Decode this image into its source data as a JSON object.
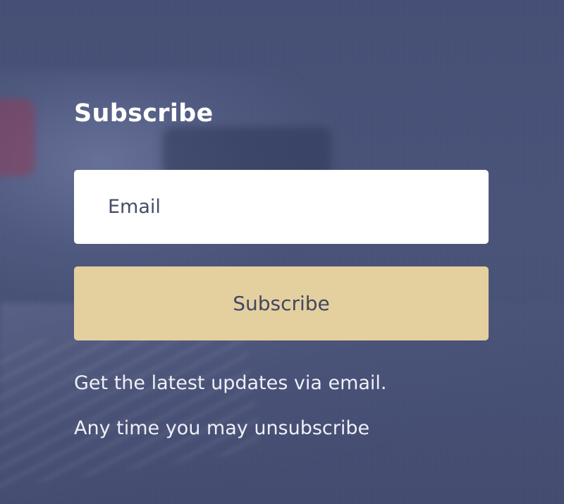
{
  "subscribe": {
    "heading": "Subscribe",
    "email_placeholder": "Email",
    "email_value": "",
    "button_label": "Subscribe",
    "note_line_1": "Get the latest updates via email.",
    "note_line_2": "Any time you may unsubscribe"
  },
  "colors": {
    "background_overlay": "#4a5578",
    "button_background": "#e4cf9f",
    "button_text": "#404861",
    "input_background": "#ffffff",
    "heading_text": "#ffffff"
  }
}
